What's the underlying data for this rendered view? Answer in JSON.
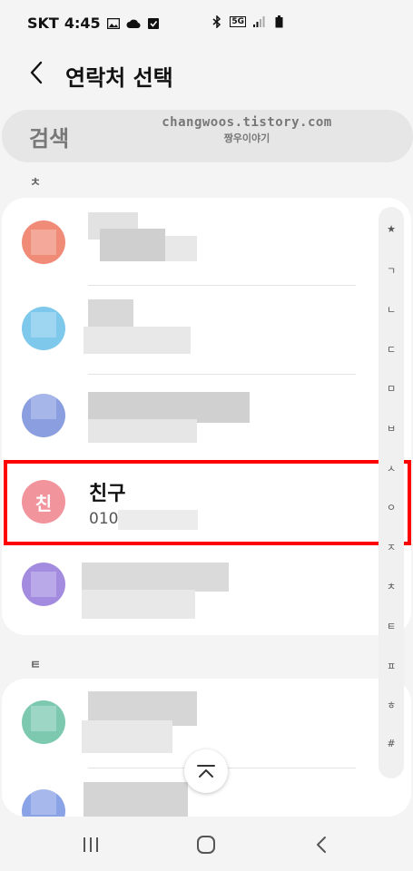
{
  "status": {
    "carrier": "SKT",
    "time": "4:45",
    "network": "5G"
  },
  "header": {
    "title": "연락처 선택"
  },
  "search": {
    "placeholder": "검색"
  },
  "watermark": {
    "line1": "changwoos.tistory.com",
    "line2": "짱우이야기"
  },
  "sections": [
    {
      "label": "ㅊ"
    },
    {
      "label": "ㅌ"
    }
  ],
  "contacts": [
    {
      "avatar_color": "#f08b78",
      "initial": ""
    },
    {
      "avatar_color": "#7ec8ec",
      "initial": ""
    },
    {
      "avatar_color": "#8a9ee0",
      "initial": ""
    },
    {
      "avatar_color": "#f2949c",
      "initial": "친",
      "name": "친구",
      "phone": "010"
    },
    {
      "avatar_color": "#a38ce0",
      "initial": ""
    },
    {
      "avatar_color": "#7cc9b0",
      "initial": ""
    },
    {
      "avatar_color": "#8aa2e6",
      "initial": ""
    }
  ],
  "index_items": [
    "★",
    "ㄱ",
    "ㄴ",
    "ㄷ",
    "ㅁ",
    "ㅂ",
    "ㅅ",
    "ㅇ",
    "ㅈ",
    "ㅊ",
    "ㅌ",
    "ㅍ",
    "ㅎ",
    "#"
  ],
  "colors": {
    "highlight": "#ff0000",
    "card": "#ffffff",
    "background": "#f4f4f4"
  }
}
